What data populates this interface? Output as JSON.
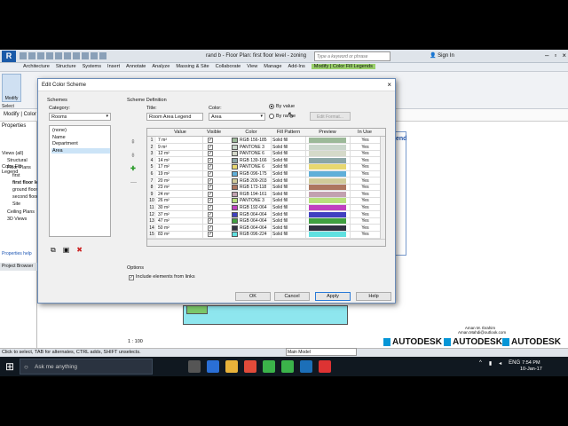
{
  "app": {
    "document_title": "rand b - Floor Plan: first floor level - zoning",
    "search_placeholder": "Type a keyword or phrase",
    "sign_in": "Sign In",
    "ribbon_tabs": [
      "Architecture",
      "Structure",
      "Systems",
      "Insert",
      "Annotate",
      "Analyze",
      "Massing & Site",
      "Collaborate",
      "View",
      "Manage",
      "Add-Ins",
      "Modify | Color Fill Legends"
    ],
    "modify_label": "Modify",
    "select_label": "Select",
    "context_label": "Modify | Color F",
    "properties_label": "Properties",
    "color_fill_legend": "Color Fill Legend",
    "properties_help": "Properties help",
    "project_browser": "Project Browser",
    "legend_title": "end",
    "scale": "1 : 100",
    "main_model": "Main Model",
    "status_text": "Click to select, TAB for alternates, CTRL adds, SHIFT unselects.",
    "author_name": "Aman M. Ibrahim",
    "author_email": "Aman.Mahdi@outlook.com",
    "brand": "AUTODESK",
    "brand_subs": [
      "Certified Professional",
      "Certified Instructor",
      "Education Expert"
    ]
  },
  "tree": [
    {
      "label": "Views (all)",
      "indent": 0
    },
    {
      "label": "Structural",
      "indent": 1
    },
    {
      "label": "Floor Plans",
      "indent": 1
    },
    {
      "label": "first",
      "indent": 2
    },
    {
      "label": "first floor level - zoning",
      "indent": 2,
      "bold": true
    },
    {
      "label": "ground floor level",
      "indent": 2
    },
    {
      "label": "second floor level",
      "indent": 2
    },
    {
      "label": "Site",
      "indent": 2
    },
    {
      "label": "Ceiling Plans",
      "indent": 1
    },
    {
      "label": "3D Views",
      "indent": 1
    }
  ],
  "dialog": {
    "title": "Edit Color Scheme",
    "close": "×",
    "schemes_label": "Schemes",
    "category_label": "Category:",
    "category_value": "Rooms",
    "schemes": [
      "(none)",
      "Name",
      "Department",
      "Area"
    ],
    "selected_scheme": "Area",
    "scheme_definition_label": "Scheme Definition",
    "title_label": "Title:",
    "title_value": "Room Area Legend",
    "color_label": "Color:",
    "color_value": "Area",
    "by_value": "By value",
    "by_range": "By range",
    "edit_format": "Edit Format...",
    "options_label": "Options",
    "include_links": "Include elements from links",
    "buttons": {
      "ok": "OK",
      "cancel": "Cancel",
      "apply": "Apply",
      "help": "Help"
    },
    "columns": [
      "Value",
      "Visible",
      "Color",
      "Fill Pattern",
      "Preview",
      "In Use"
    ],
    "rows": [
      {
        "n": "1",
        "value": "7 m²",
        "color_name": "RGB 156-185",
        "hex": "#9cb999",
        "fill": "Solid fill",
        "in_use": "Yes"
      },
      {
        "n": "2",
        "value": "9 m²",
        "color_name": "PANTONE 3",
        "hex": "#c9d6cb",
        "fill": "Solid fill",
        "in_use": "Yes"
      },
      {
        "n": "3",
        "value": "12 m²",
        "color_name": "PANTONE 6",
        "hex": "#d5d9c9",
        "fill": "Solid fill",
        "in_use": "Yes"
      },
      {
        "n": "4",
        "value": "14 m²",
        "color_name": "RGB 139-166",
        "hex": "#8ba6a6",
        "fill": "Solid fill",
        "in_use": "Yes"
      },
      {
        "n": "5",
        "value": "17 m²",
        "color_name": "PANTONE 6",
        "hex": "#e8d870",
        "fill": "Solid fill",
        "in_use": "Yes"
      },
      {
        "n": "6",
        "value": "19 m²",
        "color_name": "RGB 096-175",
        "hex": "#60afd9",
        "fill": "Solid fill",
        "in_use": "Yes"
      },
      {
        "n": "7",
        "value": "20 m²",
        "color_name": "RGB 209-203",
        "hex": "#d1cb9a",
        "fill": "Solid fill",
        "in_use": "Yes"
      },
      {
        "n": "8",
        "value": "23 m²",
        "color_name": "RGB 173-118",
        "hex": "#ad7660",
        "fill": "Solid fill",
        "in_use": "Yes"
      },
      {
        "n": "9",
        "value": "24 m²",
        "color_name": "RGB 194-161",
        "hex": "#c2a1b0",
        "fill": "Solid fill",
        "in_use": "Yes"
      },
      {
        "n": "10",
        "value": "26 m²",
        "color_name": "PANTONE 3",
        "hex": "#b8e07c",
        "fill": "Solid fill",
        "in_use": "Yes"
      },
      {
        "n": "11",
        "value": "30 m²",
        "color_name": "RGB 192-064",
        "hex": "#c040c0",
        "fill": "Solid fill",
        "in_use": "Yes"
      },
      {
        "n": "12",
        "value": "37 m²",
        "color_name": "RGB 064-064",
        "hex": "#4040c0",
        "fill": "Solid fill",
        "in_use": "Yes"
      },
      {
        "n": "13",
        "value": "47 m²",
        "color_name": "RGB 064-064",
        "hex": "#40a040",
        "fill": "Solid fill",
        "in_use": "Yes"
      },
      {
        "n": "14",
        "value": "50 m²",
        "color_name": "RGB 064-064",
        "hex": "#303040",
        "fill": "Solid fill",
        "in_use": "Yes"
      },
      {
        "n": "15",
        "value": "83 m²",
        "color_name": "RGB 096-224",
        "hex": "#60e0e0",
        "fill": "Solid fill",
        "in_use": "Yes"
      }
    ]
  },
  "taskbar": {
    "search_placeholder": "Ask me anything",
    "lang": "ENG",
    "time": "7:54 PM",
    "date": "10-Jan-17"
  }
}
